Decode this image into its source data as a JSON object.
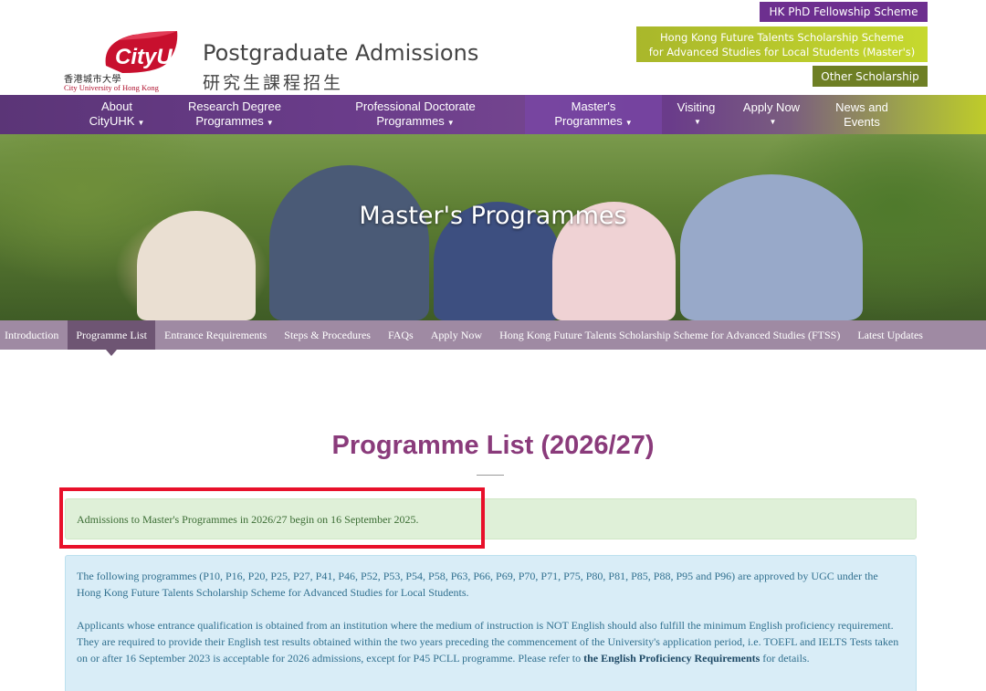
{
  "header": {
    "logo": {
      "text": "CityU",
      "cn_name": "香港城市大學",
      "en_name": "City University of Hong Kong"
    },
    "site_title": "Postgraduate Admissions",
    "site_title_cn": "研究生課程招生",
    "top_links": {
      "phd": "HK PhD Fellowship Scheme",
      "ftss_line1": "Hong Kong Future Talents Scholarship Scheme",
      "ftss_line2": "for Advanced Studies for Local Students (Master's)",
      "other": "Other Scholarship"
    }
  },
  "main_nav": [
    {
      "line1": "About",
      "line2": "CityUHK"
    },
    {
      "line1": "Research Degree",
      "line2": "Programmes"
    },
    {
      "line1": "Professional Doctorate",
      "line2": "Programmes"
    },
    {
      "line1": "Master's",
      "line2": "Programmes"
    },
    {
      "line1": "Visiting",
      "line2": ""
    },
    {
      "line1": "Apply Now",
      "line2": ""
    },
    {
      "line1": "News and",
      "line2": "Events"
    }
  ],
  "hero": {
    "title": "Master's Programmes"
  },
  "sub_nav": [
    "Introduction",
    "Programme List",
    "Entrance Requirements",
    "Steps & Procedures",
    "FAQs",
    "Apply Now",
    "Hong Kong Future Talents Scholarship Scheme for Advanced Studies (FTSS)",
    "Latest Updates"
  ],
  "content": {
    "heading": "Programme List (2026/27)",
    "success_notice": "Admissions to Master's Programmes in 2026/27 begin on 16 September 2025.",
    "info_para1": "The following programmes (P10, P16, P20, P25, P27, P41, P46, P52, P53, P54, P58, P63, P66, P69, P70, P71, P75, P80, P81, P85, P88, P95 and P96) are approved by UGC under the Hong Kong Future Talents Scholarship Scheme for Advanced Studies for Local Students.",
    "info_para2_before": "Applicants whose entrance qualification is obtained from an institution where the medium of instruction is NOT English should also fulfill the minimum English proficiency requirement. They are required to provide their English test results obtained within the two years preceding the commencement of the University's application period, i.e. TOEFL and IELTS Tests taken on or after 16 September 2023 is acceptable for 2026 admissions, except for P45 PCLL programme. Please refer to ",
    "info_para2_link": "the English Proficiency Requirements",
    "info_para2_after": " for details."
  },
  "colors": {
    "brand_purple": "#6d2f8f",
    "brand_red": "#c8102e",
    "heading": "#8a3b7b",
    "highlight": "#e8102a"
  }
}
